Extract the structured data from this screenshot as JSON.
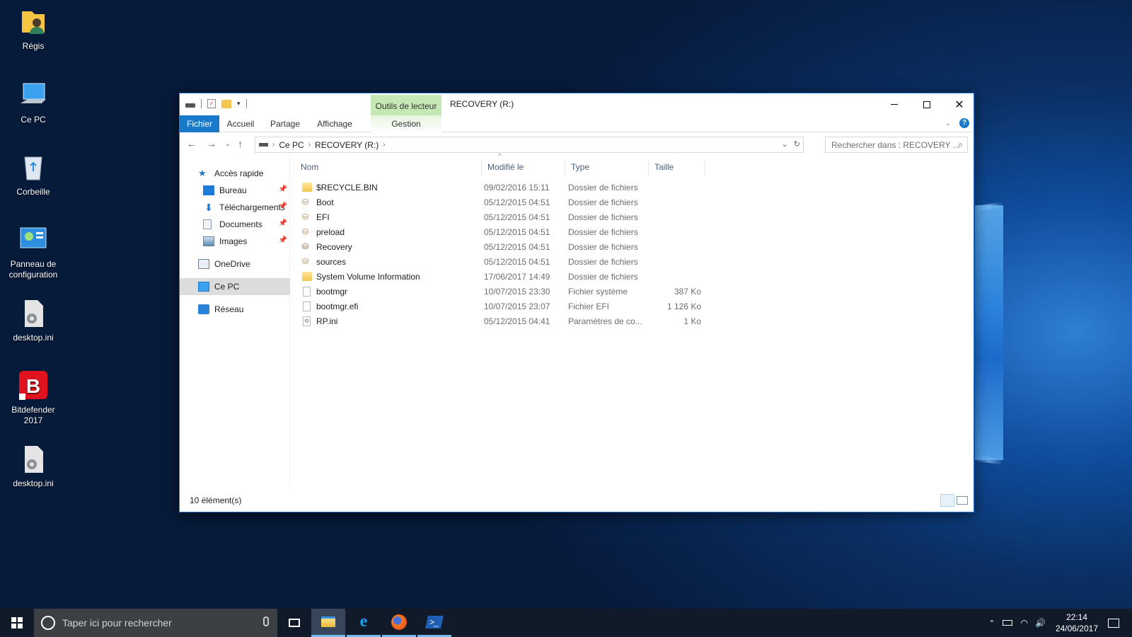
{
  "desktop": {
    "icons": [
      {
        "label": "Régis",
        "icon": "user-folder-icon"
      },
      {
        "label": "Ce PC",
        "icon": "computer-icon"
      },
      {
        "label": "Corbeille",
        "icon": "recycle-bin-icon"
      },
      {
        "label": "Panneau de configuration",
        "icon": "control-panel-icon"
      },
      {
        "label": "desktop.ini",
        "icon": "settings-file-icon"
      },
      {
        "label": "Bitdefender 2017",
        "icon": "bitdefender-icon"
      },
      {
        "label": "desktop.ini",
        "icon": "settings-file-icon"
      }
    ]
  },
  "window": {
    "title": "RECOVERY (R:)",
    "context_tab_group": "Outils de lecteur",
    "ribbon_tabs": [
      "Fichier",
      "Accueil",
      "Partage",
      "Affichage",
      "Gestion"
    ],
    "address": {
      "crumbs": [
        "Ce PC",
        "RECOVERY (R:)"
      ]
    },
    "search": {
      "placeholder": "Rechercher dans : RECOVERY ..."
    },
    "nav": [
      {
        "label": "Accès rapide",
        "icon": "star-icon",
        "pinned": false
      },
      {
        "label": "Bureau",
        "icon": "desktop-folder-icon",
        "pinned": true
      },
      {
        "label": "Téléchargements",
        "icon": "download-icon",
        "pinned": true
      },
      {
        "label": "Documents",
        "icon": "documents-icon",
        "pinned": true
      },
      {
        "label": "Images",
        "icon": "pictures-icon",
        "pinned": true
      },
      {
        "label": "OneDrive",
        "icon": "onedrive-icon",
        "pinned": false
      },
      {
        "label": "Ce PC",
        "icon": "computer-icon",
        "pinned": false,
        "selected": true
      },
      {
        "label": "Réseau",
        "icon": "network-icon",
        "pinned": false
      }
    ],
    "columns": {
      "name": "Nom",
      "modified": "Modifié le",
      "type": "Type",
      "size": "Taille"
    },
    "files": [
      {
        "name": "$RECYCLE.BIN",
        "modified": "09/02/2016 15:11",
        "type": "Dossier de fichiers",
        "size": "",
        "icon": "folder-icon"
      },
      {
        "name": "Boot",
        "modified": "05/12/2015 04:51",
        "type": "Dossier de fichiers",
        "size": "",
        "icon": "system-folder-icon"
      },
      {
        "name": "EFI",
        "modified": "05/12/2015 04:51",
        "type": "Dossier de fichiers",
        "size": "",
        "icon": "system-folder-icon"
      },
      {
        "name": "preload",
        "modified": "05/12/2015 04:51",
        "type": "Dossier de fichiers",
        "size": "",
        "icon": "system-folder-icon"
      },
      {
        "name": "Recovery",
        "modified": "05/12/2015 04:51",
        "type": "Dossier de fichiers",
        "size": "",
        "icon": "system-folder-icon"
      },
      {
        "name": "sources",
        "modified": "05/12/2015 04:51",
        "type": "Dossier de fichiers",
        "size": "",
        "icon": "system-folder-icon"
      },
      {
        "name": "System Volume Information",
        "modified": "17/06/2017 14:49",
        "type": "Dossier de fichiers",
        "size": "",
        "icon": "folder-icon"
      },
      {
        "name": "bootmgr",
        "modified": "10/07/2015 23:30",
        "type": "Fichier système",
        "size": "387 Ko",
        "icon": "file-icon"
      },
      {
        "name": "bootmgr.efi",
        "modified": "10/07/2015 23:07",
        "type": "Fichier EFI",
        "size": "1 126 Ko",
        "icon": "file-icon"
      },
      {
        "name": "RP.ini",
        "modified": "05/12/2015 04:41",
        "type": "Paramètres de co...",
        "size": "1 Ko",
        "icon": "settings-file-icon"
      }
    ],
    "status": "10 élément(s)"
  },
  "taskbar": {
    "search_placeholder": "Taper ici pour rechercher",
    "apps": [
      "file-explorer-icon",
      "edge-icon",
      "firefox-icon",
      "powershell-icon"
    ],
    "time": "22:14",
    "date": "24/06/2017"
  },
  "colors": {
    "accent": "#1979ca",
    "context_tab": "#c6e8b5",
    "taskbar": "#101a28"
  }
}
